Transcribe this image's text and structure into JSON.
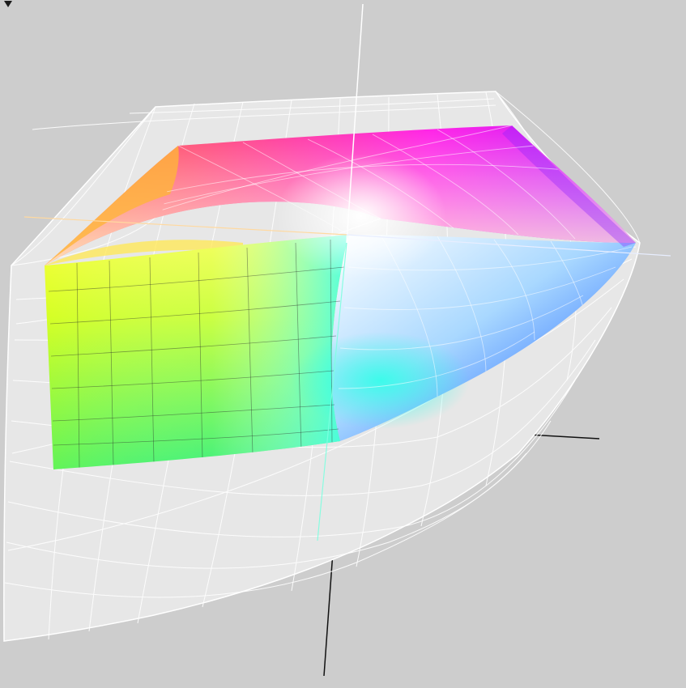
{
  "viewer": {
    "background": "#cdcdcd",
    "menu_icon": "triangle-down-icon",
    "outer_gamut_color": "#e6e6e6",
    "outer_mesh_color": "#ffffff",
    "axis_colors": {
      "vertical_top": "#ffffff",
      "vertical_bottom": "#7fffe0",
      "horizontal_left": "#ffd9a0",
      "horizontal_right": "#e0e8ff",
      "dark_axes": "#111111"
    },
    "inner_gamut_colors": [
      "#ff2a2a",
      "#ff00ff",
      "#7a3cff",
      "#00e0ff",
      "#00ff40",
      "#ffff30",
      "#ffffff"
    ]
  }
}
